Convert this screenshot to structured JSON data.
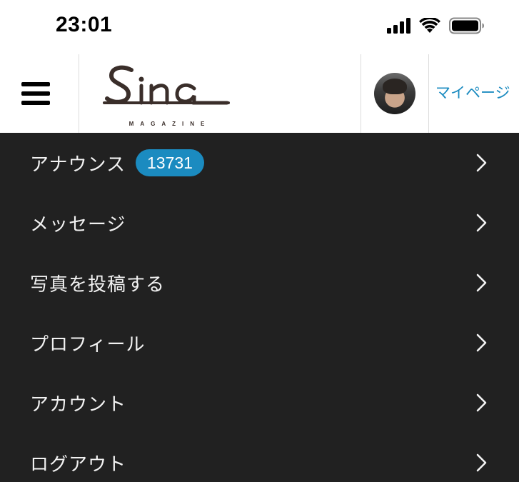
{
  "status_bar": {
    "time": "23:01",
    "icons": [
      "cellular-signal-icon",
      "wifi-icon",
      "battery-icon"
    ]
  },
  "header": {
    "menu_icon": "hamburger-icon",
    "logo_text": "Sina",
    "logo_subtext": "MAGAZINE",
    "mypage_label": "マイページ"
  },
  "menu": {
    "items": [
      {
        "label": "アナウンス",
        "badge": "13731"
      },
      {
        "label": "メッセージ"
      },
      {
        "label": "写真を投稿する"
      },
      {
        "label": "プロフィール"
      },
      {
        "label": "アカウント"
      },
      {
        "label": "ログアウト"
      }
    ]
  },
  "colors": {
    "accent": "#1b8bc0",
    "drawer_background": "#212121",
    "menu_text": "#f2f2f2",
    "divider": "#dcdcdc"
  }
}
